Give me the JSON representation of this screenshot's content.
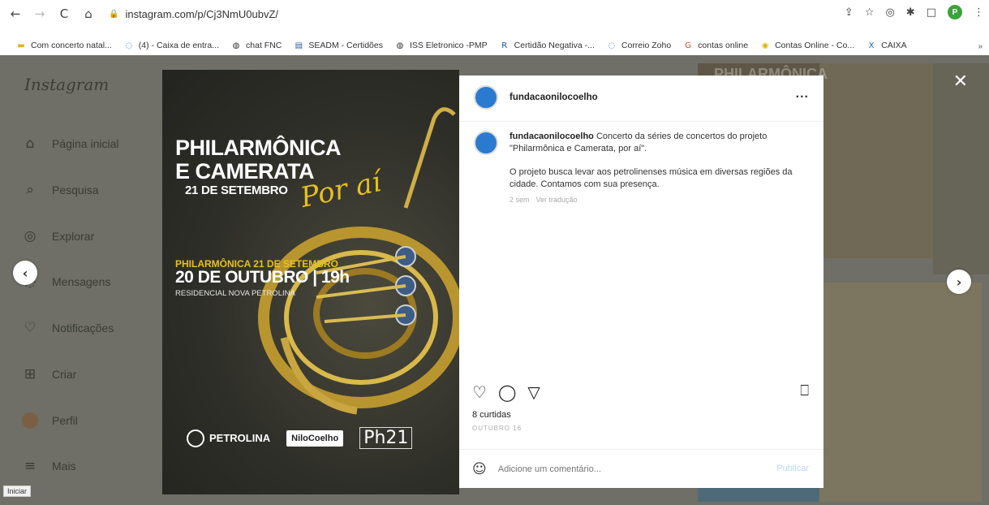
{
  "browser": {
    "back": "←",
    "forward": "→",
    "reload": "C",
    "home": "⌂",
    "lock": "🔒",
    "url": "instagram.com/p/Cj3NmU0ubvZ/",
    "icons": {
      "share": "⇪",
      "star": "☆",
      "camera": "◎",
      "puzzle": "✱",
      "panel": "□",
      "menu": "⋮"
    },
    "profile_letter": "P"
  },
  "bookmarks": [
    {
      "label": "Com concerto natal...",
      "icon": "folder-icon",
      "glyph": "▬",
      "color": "#e3b21c"
    },
    {
      "label": "(4) - Caixa de entra...",
      "icon": "mail-icon",
      "glyph": "◌",
      "color": "#2a7bd0"
    },
    {
      "label": "chat FNC",
      "icon": "globe-icon",
      "glyph": "◍",
      "color": "#333333"
    },
    {
      "label": "SEADM - Certidões",
      "icon": "seadm-icon",
      "glyph": "▤",
      "color": "#2a5a9a"
    },
    {
      "label": "ISS Eletronico -PMP",
      "icon": "globe-icon",
      "glyph": "◍",
      "color": "#333333"
    },
    {
      "label": "Certidão Negativa -...",
      "icon": "r-icon",
      "glyph": "R",
      "color": "#1f4fa3"
    },
    {
      "label": "Correio Zoho",
      "icon": "mail-icon",
      "glyph": "◌",
      "color": "#2a7bd0"
    },
    {
      "label": "contas online",
      "icon": "google-icon",
      "glyph": "G",
      "color": "#db4437"
    },
    {
      "label": "Contas Online - Co...",
      "icon": "circle-icon",
      "glyph": "◉",
      "color": "#e0b400"
    },
    {
      "label": "CAIXA",
      "icon": "caixa-icon",
      "glyph": "X",
      "color": "#1c6bb3"
    }
  ],
  "bookmarks_more": "»",
  "instagram": {
    "brand": "Instagram",
    "nav": [
      {
        "label": "Página inicial",
        "icon": "home-icon",
        "glyph": "⌂"
      },
      {
        "label": "Pesquisa",
        "icon": "search-icon",
        "glyph": "⌕"
      },
      {
        "label": "Explorar",
        "icon": "compass-icon",
        "glyph": "◎"
      },
      {
        "label": "Mensagens",
        "icon": "messenger-icon",
        "glyph": "◌"
      },
      {
        "label": "Notificações",
        "icon": "heart-icon",
        "glyph": "♡"
      },
      {
        "label": "Criar",
        "icon": "plus-square-icon",
        "glyph": "⊞"
      },
      {
        "label": "Perfil",
        "icon": "avatar",
        "glyph": ""
      },
      {
        "label": "Mais",
        "icon": "menu-icon",
        "glyph": "≡"
      }
    ],
    "close": "✕",
    "prev": "‹",
    "next": "›"
  },
  "post_image": {
    "title_line1": "PHILARMÔNICA",
    "title_line2": "E CAMERATA",
    "date_top": "21 DE SETEMBRO",
    "script": "Por aí",
    "sub": "PHILARMÔNICA 21 DE SETEMBRO",
    "event": "20 DE OUTUBRO | 19h",
    "place": "RESIDENCIAL NOVA PETROLINA",
    "logo_petrolina": "PETROLINA",
    "logo_nilo": "NiloCoelho",
    "logo_ph": "Ph21"
  },
  "background_post_text": "PHILARMÔNICA",
  "post": {
    "username": "fundacaonilocoelho",
    "more": "...",
    "caption_user": "fundacaonilocoelho",
    "caption_p1": "Concerto da séries de concertos do projeto \"Philarmônica e Camerata, por aí\".",
    "caption_p2": "O projeto busca levar aos petrolinenses música em diversas regiões da cidade. Contamos com sua presença.",
    "caption_time": "2 sem",
    "translate": "Ver tradução",
    "like_icon": "♡",
    "comment_icon": "◯",
    "share_icon": "▽",
    "save_icon": "⎕",
    "likes": "8 curtidas",
    "date": "OUTUBRO 16",
    "emoji_icon": "☺",
    "comment_placeholder": "Adicione um comentário...",
    "publish": "Publicar"
  },
  "status_bar": "Iniciar"
}
